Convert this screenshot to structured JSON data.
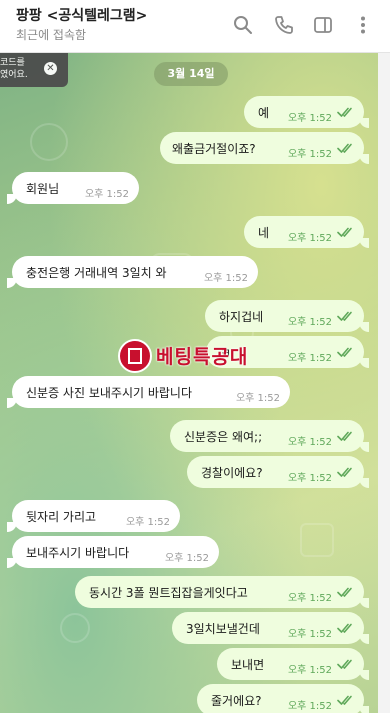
{
  "header": {
    "title": "팡팡 <공식텔레그램>",
    "subtitle": "최근에 접속함",
    "icons": [
      "search-icon",
      "phone-icon",
      "sidebar-icon",
      "more-icon"
    ]
  },
  "toast": {
    "text": "코드를\n였어요.",
    "close_icon": "close-icon"
  },
  "date_label": "3월 14일",
  "watermark": {
    "text": "베팅특공대",
    "logo": "logo-icon"
  },
  "messages": [
    {
      "dir": "out",
      "text": "예",
      "time": "오후 1:52",
      "status": "read"
    },
    {
      "dir": "out",
      "text": "왜출금거절이죠?",
      "time": "오후 1:52",
      "status": "read"
    },
    {
      "dir": "in",
      "text": "회원님",
      "time": "오후 1:52"
    },
    {
      "dir": "out",
      "text": "네",
      "time": "오후 1:52",
      "status": "read"
    },
    {
      "dir": "in",
      "text": "충전은행 거래내역 3일치 와",
      "time": "오후 1:52"
    },
    {
      "dir": "out",
      "text": "하지겁네",
      "time": "오후 1:52",
      "status": "read"
    },
    {
      "dir": "out",
      "text": "ㅋ",
      "time": "오후 1:52",
      "status": "read"
    },
    {
      "dir": "in",
      "text": "신분증 사진 보내주시기 바랍니다",
      "time": "오후 1:52"
    },
    {
      "dir": "out",
      "text": "신분증은 왜여;;",
      "time": "오후 1:52",
      "status": "read"
    },
    {
      "dir": "out",
      "text": "경찰이에요?",
      "time": "오후 1:52",
      "status": "read"
    },
    {
      "dir": "in",
      "text": "뒷자리 가리고",
      "time": "오후 1:52"
    },
    {
      "dir": "in",
      "text": "보내주시기 바랍니다",
      "time": "오후 1:52"
    },
    {
      "dir": "out",
      "text": "동시간 3폴 뭔트집잡을게잇다고",
      "time": "오후 1:52",
      "status": "read"
    },
    {
      "dir": "out",
      "text": "3일치보낼건데",
      "time": "오후 1:52",
      "status": "read"
    },
    {
      "dir": "out",
      "text": "보내면",
      "time": "오후 1:52",
      "status": "read"
    },
    {
      "dir": "out",
      "text": "줄거에요?",
      "time": "오후 1:52",
      "status": "read"
    }
  ]
}
